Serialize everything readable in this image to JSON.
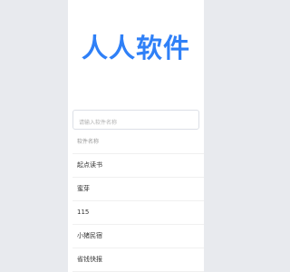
{
  "header": {
    "logo_text": "人人软件"
  },
  "search": {
    "placeholder": "请输入软件名称",
    "value": ""
  },
  "list": {
    "column_header": "软件名称",
    "items": [
      {
        "label": "起点读书"
      },
      {
        "label": "蜜芽"
      },
      {
        "label": "115"
      },
      {
        "label": "小猪民宿"
      },
      {
        "label": "省钱快报"
      }
    ]
  }
}
